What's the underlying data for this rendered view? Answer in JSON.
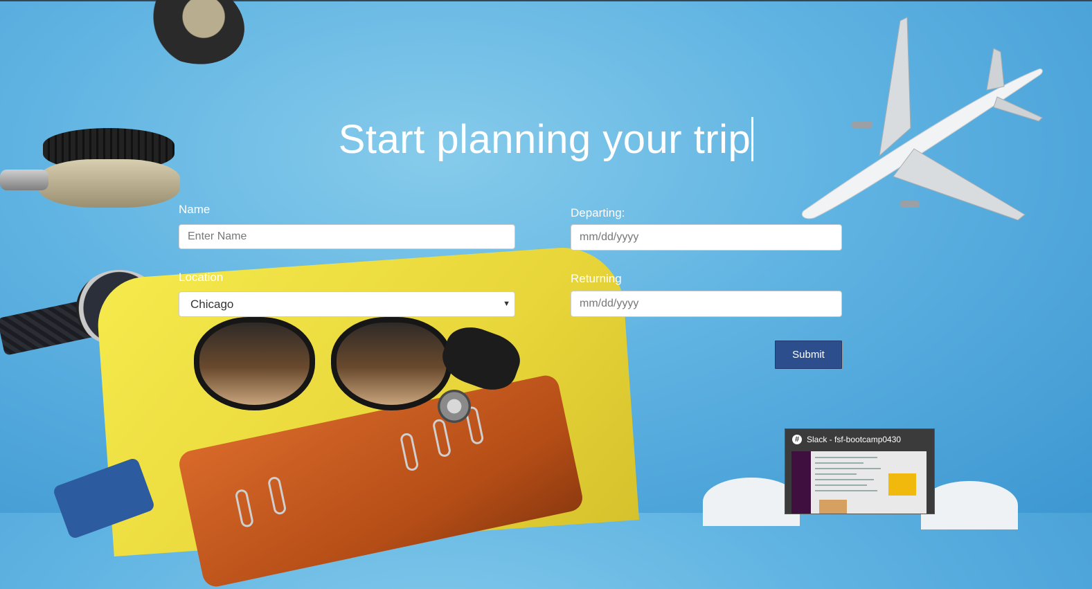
{
  "heading": "Start planning your trip",
  "form": {
    "name": {
      "label": "Name",
      "placeholder": "Enter Name",
      "value": ""
    },
    "location": {
      "label": "Location",
      "selected": "Chicago"
    },
    "departing": {
      "label": "Departing:",
      "placeholder": "mm/dd/yyyy"
    },
    "returning": {
      "label": "Returning",
      "placeholder": "mm/dd/yyyy"
    },
    "submit_label": "Submit"
  },
  "taskbar_preview": {
    "title": "Slack - fsf-bootcamp0430",
    "icon": "slack-icon"
  },
  "colors": {
    "background": "#5fb3e2",
    "submit_button": "#2c4e8c",
    "text_light": "#ffffff"
  }
}
